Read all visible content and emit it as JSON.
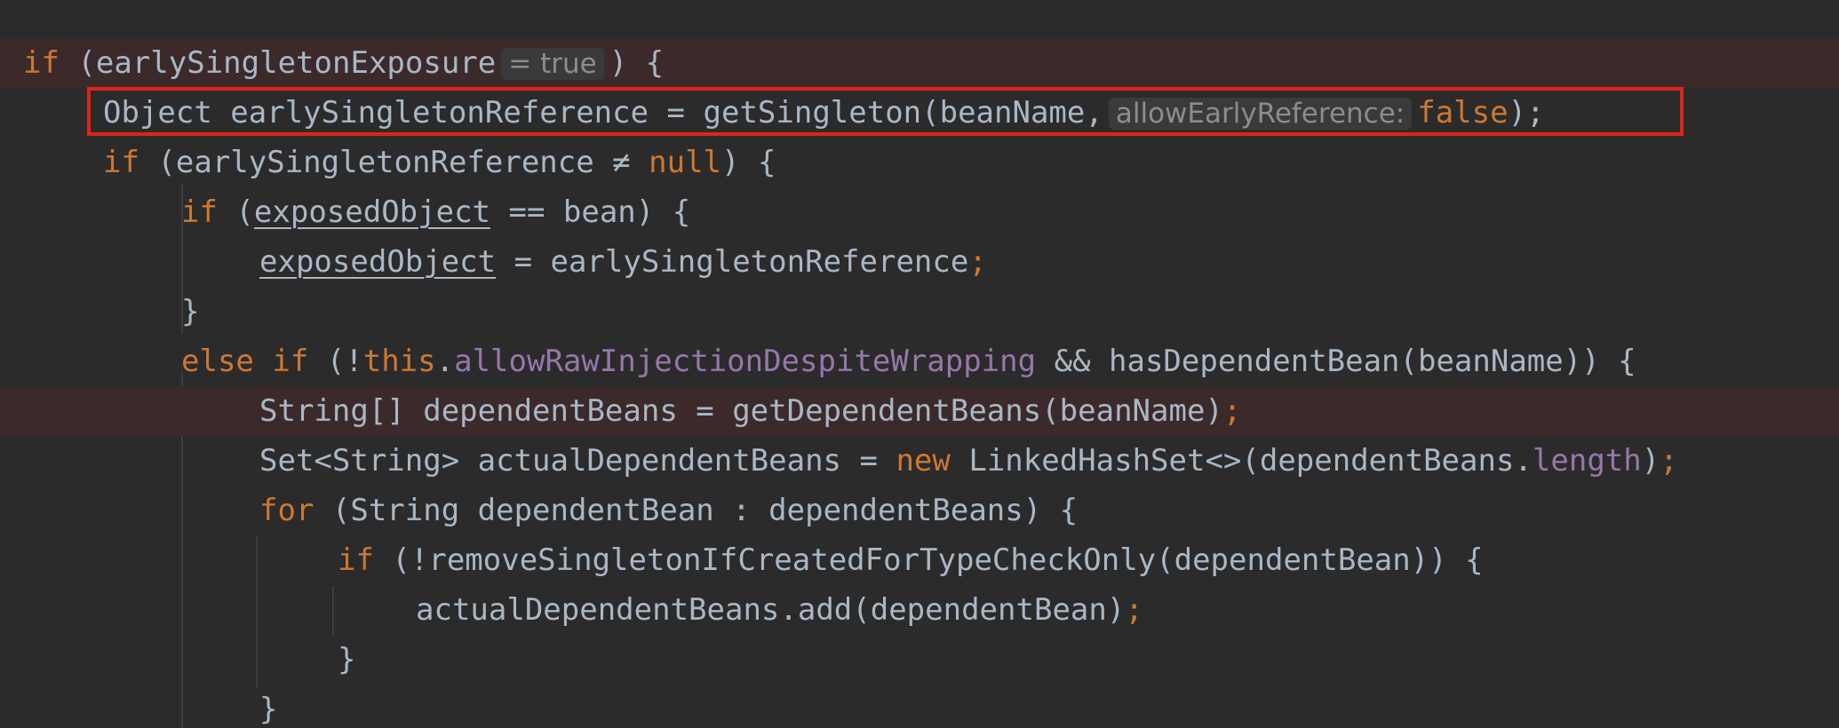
{
  "editor": {
    "inline_hint_value": "= true",
    "param_hint": "allowEarlyReference:",
    "lines": [
      {
        "t1": "if",
        "t2": " (earlySingletonExposure"
      },
      {
        "t1": "Object earlySingletonReference = getSingleton(beanName,",
        "t2": "false",
        "t3": ");"
      },
      {
        "t1": "if",
        "t2": " (earlySingletonReference ",
        "t3": "≠",
        "t4": " null",
        "t5": ") {"
      },
      {
        "t1": "if",
        "t2": " (",
        "t3": "exposedObject",
        "t4": " == bean) {"
      },
      {
        "t1": "exposedObject",
        "t2": " = earlySingletonReference",
        "t3": ";"
      },
      {
        "t1": "}"
      },
      {
        "t1": "else if",
        "t2": " (!",
        "t3": "this",
        "t4": ".",
        "t5": "allowRawInjectionDespiteWrapping",
        "t6": " && hasDependentBean(beanName)) {"
      },
      {
        "t1": "String[] dependentBeans = getDependentBeans(beanName)",
        "t2": ";"
      },
      {
        "t1": "Set<String> actualDependentBeans = ",
        "t2": "new",
        "t3": " LinkedHashSet<>(dependentBeans.",
        "t4": "length",
        "t5": ")",
        "t6": ";"
      },
      {
        "t1": "for",
        "t2": " (String dependentBean : dependentBeans) {"
      },
      {
        "t1": "if",
        "t2": " (!removeSingletonIfCreatedForTypeCheckOnly(dependentBean)) {"
      },
      {
        "t1": "actualDependentBeans.add(dependentBean)",
        "t2": ";"
      },
      {
        "t1": "}"
      },
      {
        "t1": "}"
      }
    ],
    "line0_tail": ") {"
  }
}
